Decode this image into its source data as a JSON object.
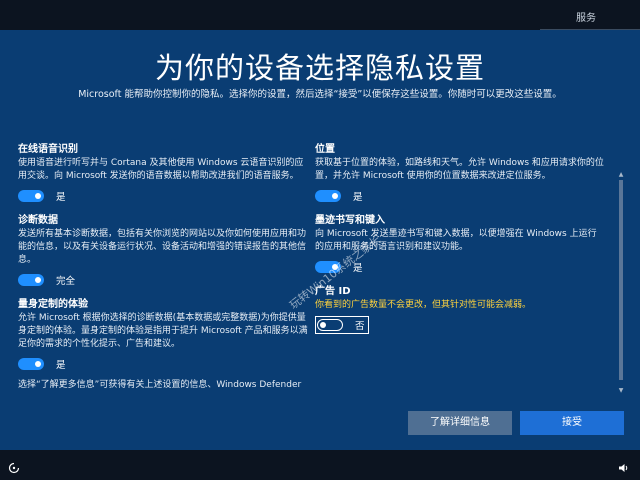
{
  "topbar": {
    "service_label": "服务"
  },
  "page": {
    "title": "为你的设备选择隐私设置",
    "subtitle": "Microsoft 能帮助你控制你的隐私。选择你的设置，然后选择“接受”以便保存这些设置。你随时可以更改这些设置。"
  },
  "left": [
    {
      "title": "在线语音识别",
      "desc": "使用语音进行听写并与 Cortana 及其他使用 Windows 云语音识别的应用交谈。向 Microsoft 发送你的语音数据以帮助改进我们的语音服务。",
      "toggle_state": "on",
      "toggle_label": "是"
    },
    {
      "title": "诊断数据",
      "desc": "发送所有基本诊断数据，包括有关你浏览的网站以及你如何使用应用和功能的信息，以及有关设备运行状况、设备活动和增强的错误报告的其他信息。",
      "toggle_state": "on",
      "toggle_label": "完全"
    },
    {
      "title": "量身定制的体验",
      "desc": "允许 Microsoft 根据你选择的诊断数据(基本数据或完整数据)为你提供量身定制的体验。量身定制的体验是指用于提升 Microsoft 产品和服务以满足你的需求的个性化提示、广告和建议。",
      "toggle_state": "on",
      "toggle_label": "是"
    }
  ],
  "left_cut_text": "选择“了解更多信息”可获得有关上述设置的信息、Windows Defender",
  "right": [
    {
      "title": "位置",
      "desc": "获取基于位置的体验，如路线和天气。允许 Windows 和应用请求你的位置，并允许 Microsoft 使用你的位置数据来改进定位服务。",
      "toggle_state": "on",
      "toggle_label": "是"
    },
    {
      "title": "墨迹书写和键入",
      "desc": "向 Microsoft 发送墨迹书写和键入数据，以便增强在 Windows 上运行的应用和服务的语言识别和建议功能。",
      "toggle_state": "on",
      "toggle_label": "是"
    },
    {
      "title": "广告 ID",
      "desc": "你看到的广告数量不会更改，但其针对性可能会减弱。",
      "toggle_state": "off",
      "toggle_label": "否"
    }
  ],
  "buttons": {
    "learn_more": "了解详细信息",
    "accept": "接受"
  },
  "watermark": "玩转Win10系统之家长",
  "colors": {
    "background": "#0a3d73",
    "accent": "#1e6fd6",
    "toggle_on": "#1f8fff",
    "warning_text": "#ffd33d"
  },
  "icons": {
    "bottom_left": "ease-of-access-icon",
    "bottom_right": "volume-icon"
  }
}
